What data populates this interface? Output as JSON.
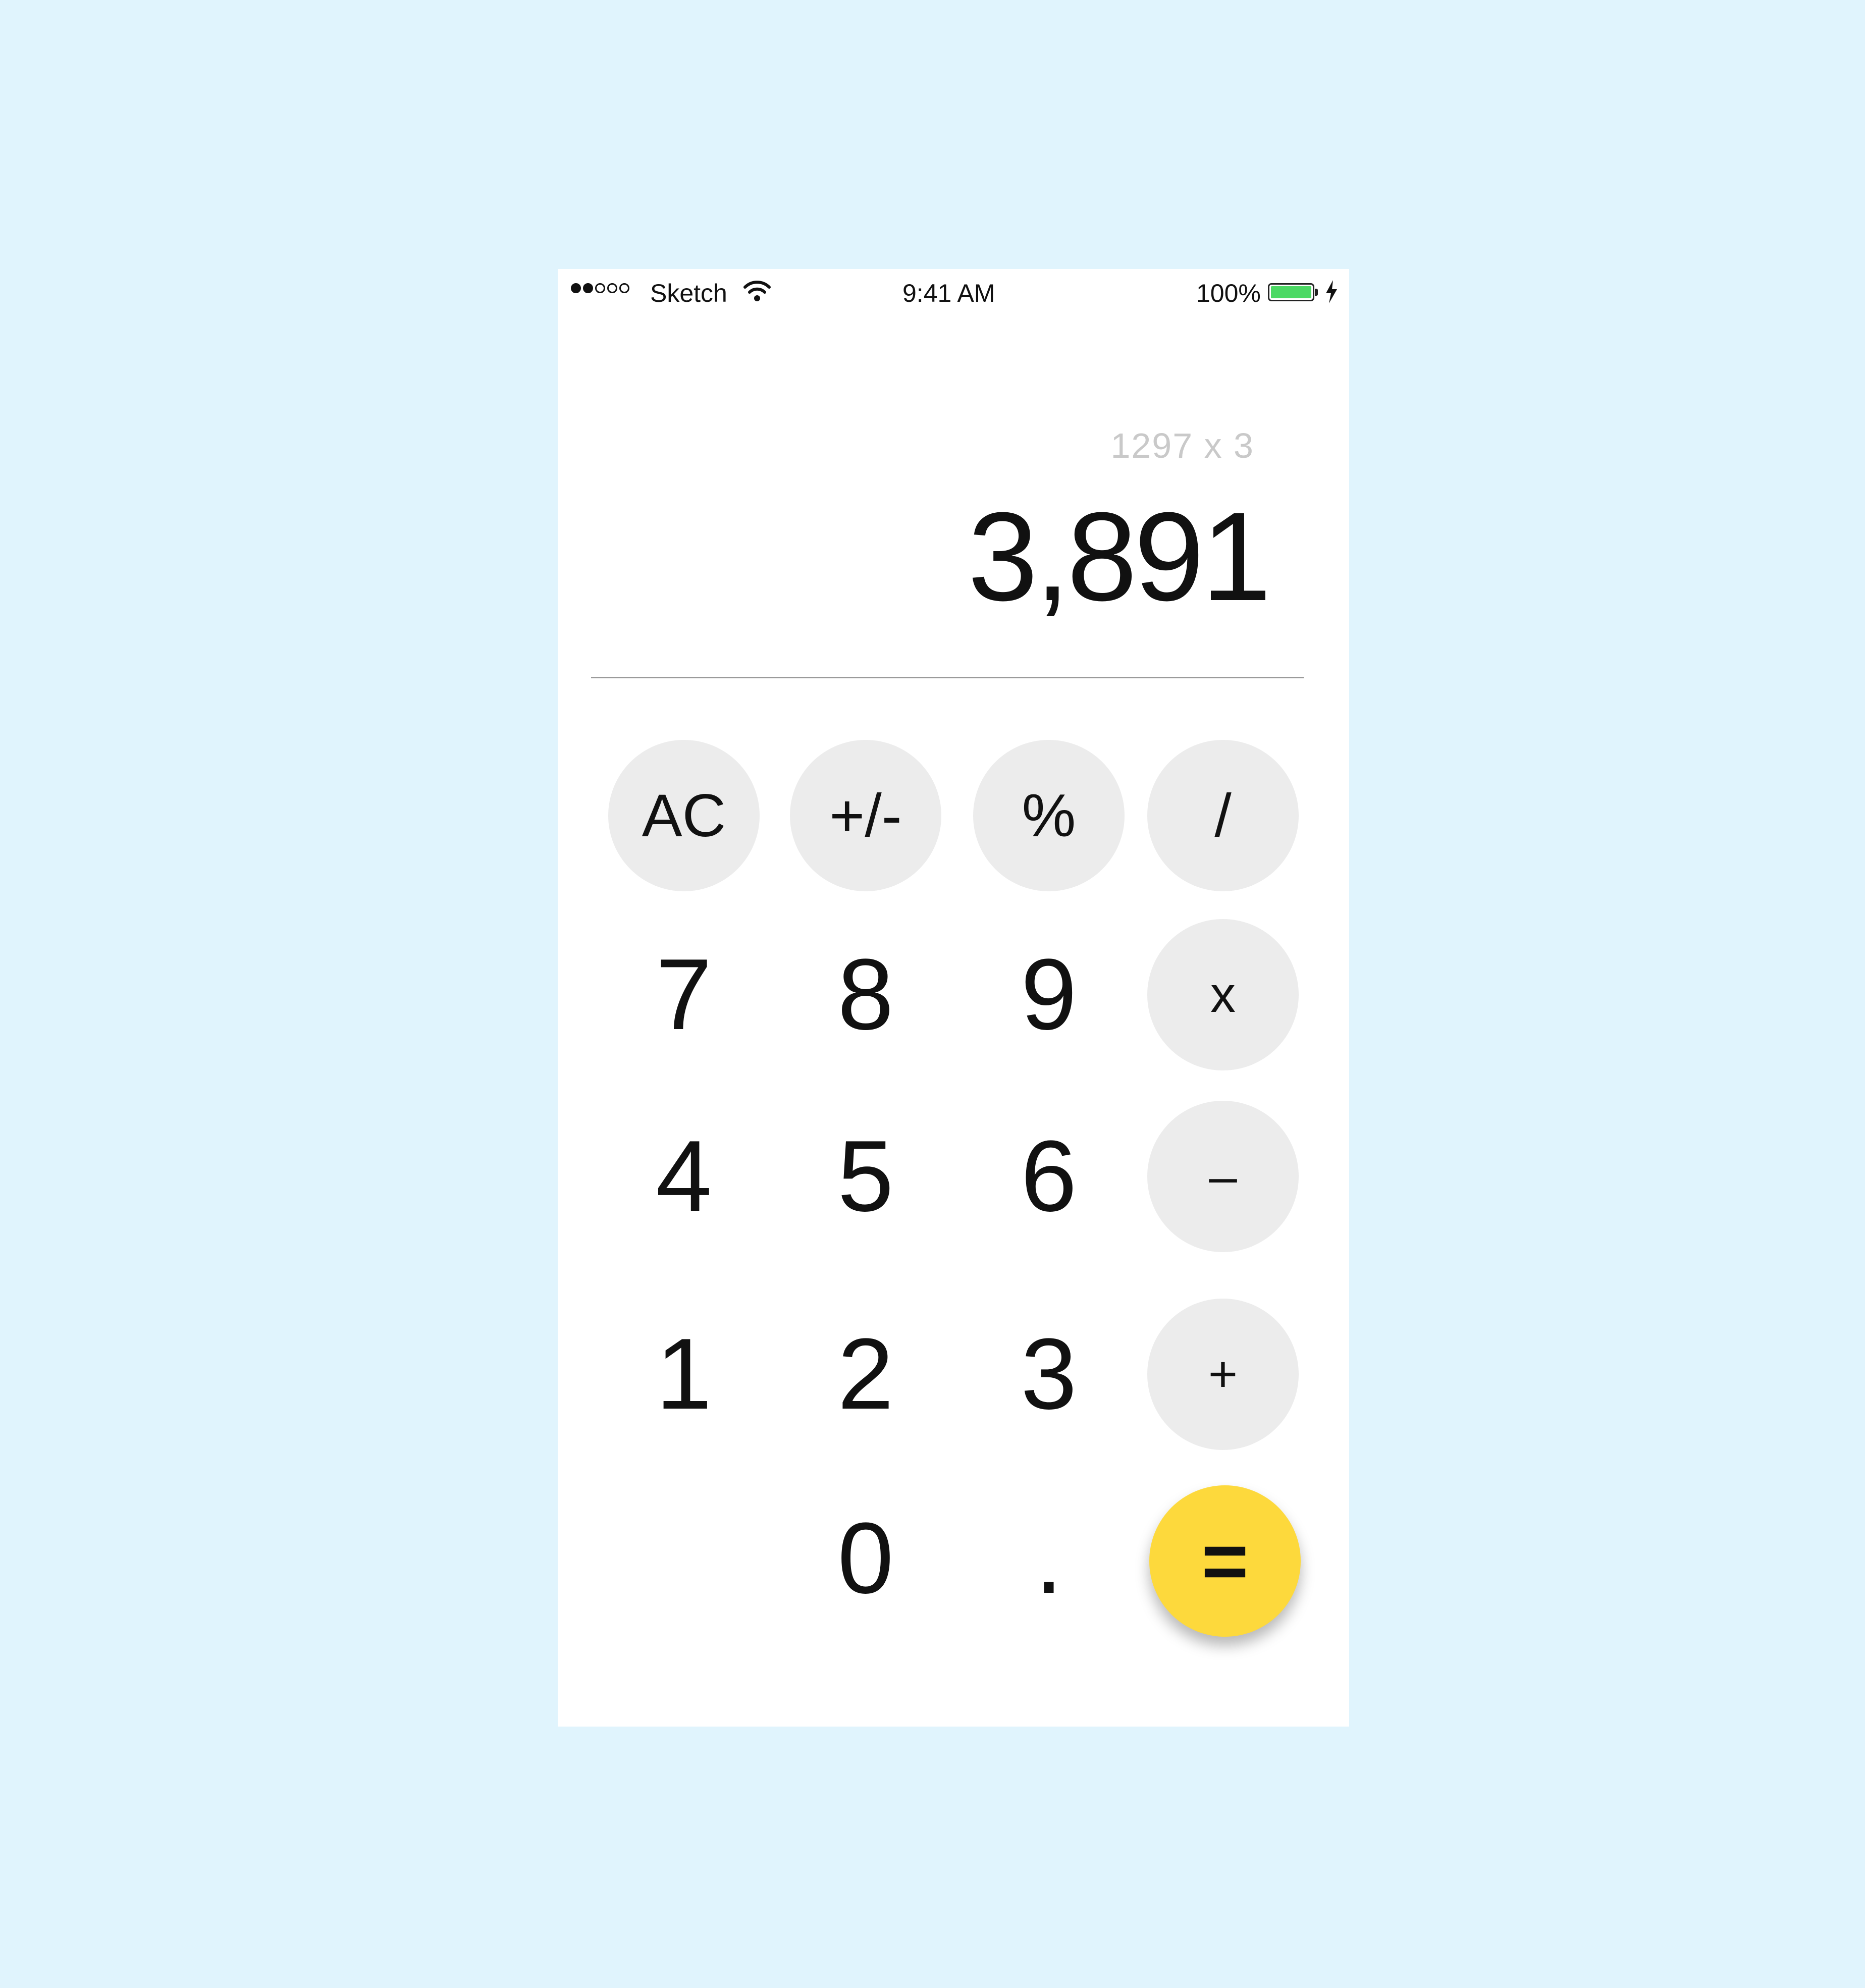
{
  "status_bar": {
    "carrier": "Sketch",
    "time": "9:41 AM",
    "battery_percent": "100%",
    "battery_color": "#4cd964",
    "signal_bars_filled": 2,
    "signal_bars_total": 5
  },
  "display": {
    "expression": "1297 x 3",
    "result": "3,891"
  },
  "keypad": {
    "ac": "AC",
    "plus_minus": "+/-",
    "percent": "%",
    "divide": "/",
    "seven": "7",
    "eight": "8",
    "nine": "9",
    "multiply": "x",
    "four": "4",
    "five": "5",
    "six": "6",
    "minus": "–",
    "one": "1",
    "two": "2",
    "three": "3",
    "plus": "+",
    "zero": "0",
    "decimal": ".",
    "equals": "="
  },
  "colors": {
    "background": "#e0f4fd",
    "function_key": "#ececec",
    "equals_key": "#fdd93c"
  }
}
